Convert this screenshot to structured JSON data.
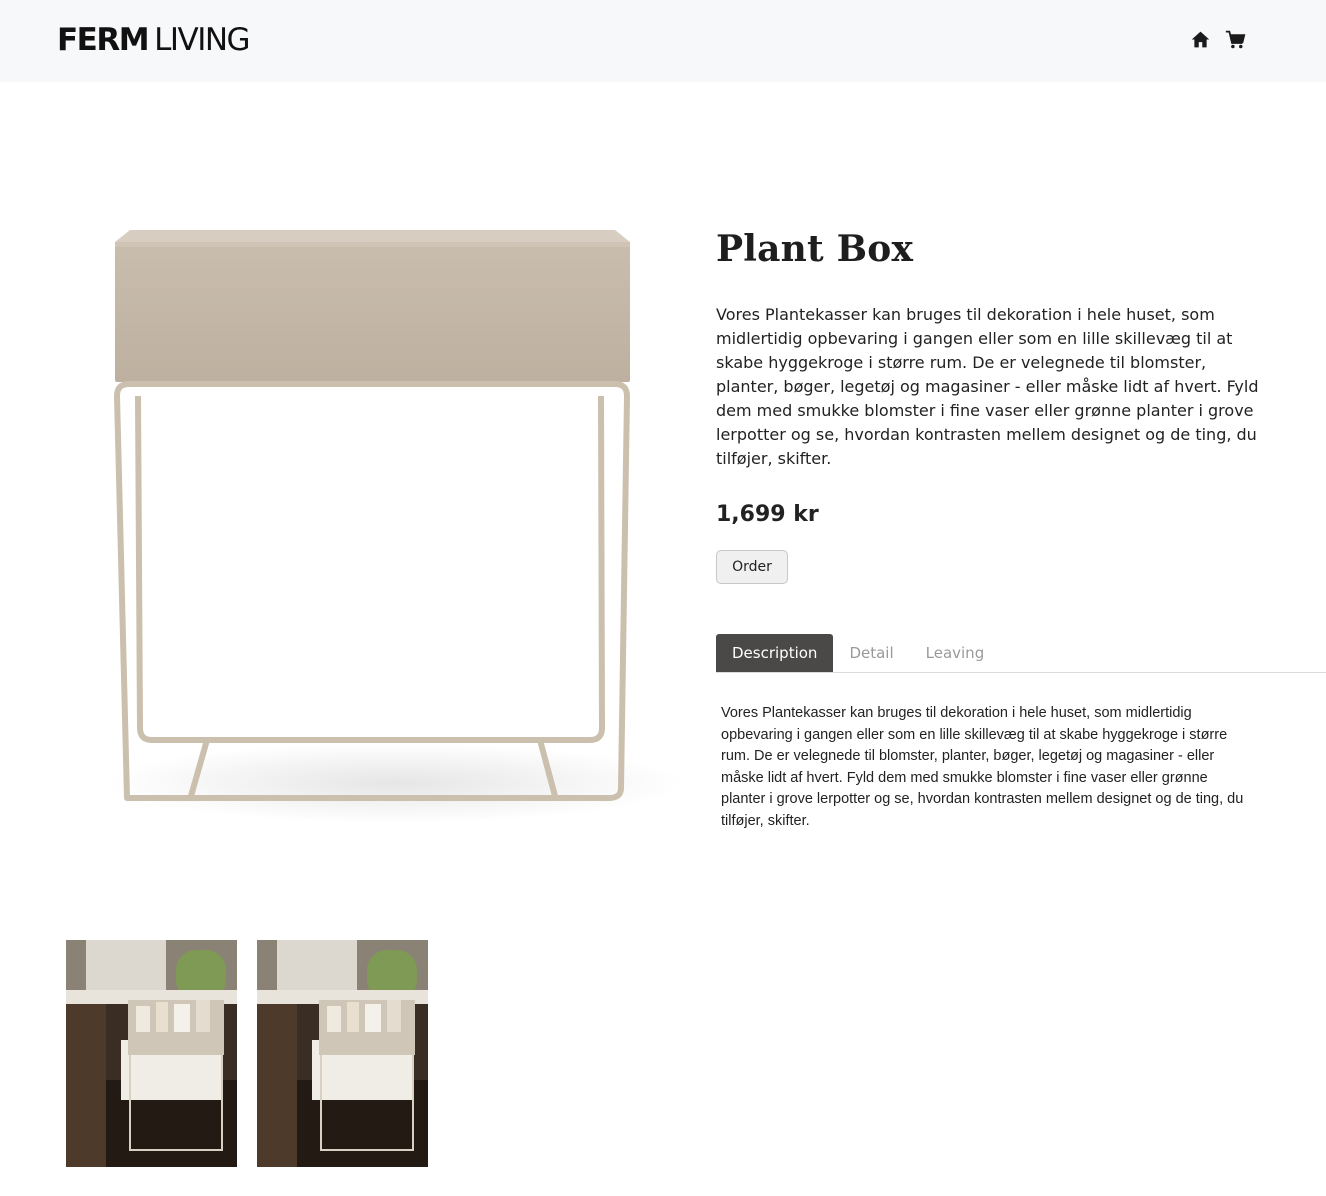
{
  "header": {
    "brand_bold": "FERM",
    "brand_light": "LIVING",
    "icons": [
      "home-icon",
      "cart-icon"
    ]
  },
  "product": {
    "title": "Plant Box",
    "description": "Vores Plantekasser kan bruges til dekoration i hele huset, som midlertidig opbevaring i gangen eller som en lille skillevæg til at skabe hyggekroge i større rum. De er velegnede til blomster, planter, bøger, legetøj og magasiner - eller måske lidt af hvert. Fyld dem med smukke blomster i fine vaser eller grønne planter i grove lerpotter og se, hvordan kontrasten mellem designet og de ting, du tilføjer, skifter.",
    "price": "1,699 kr",
    "order_label": "Order",
    "colors": {
      "box": "#c4b8a8",
      "frame": "#cbbfae"
    }
  },
  "tabs": {
    "items": [
      {
        "label": "Description",
        "active": true
      },
      {
        "label": "Detail",
        "active": false
      },
      {
        "label": "Leaving",
        "active": false
      }
    ],
    "content": "Vores Plantekasser kan bruges til dekoration i hele huset, som midlertidig opbevaring i gangen eller som en lille skillevæg til at skabe hyggekroge i større rum. De er velegnede til blomster, planter, bøger, legetøj og magasiner - eller måske lidt af hvert. Fyld dem med smukke blomster i fine vaser eller grønne planter i grove lerpotter og se, hvordan kontrasten mellem designet og de ting, du tilføjer, skifter."
  },
  "gallery": {
    "thumbnails": [
      "room-photo",
      "room-photo"
    ]
  }
}
